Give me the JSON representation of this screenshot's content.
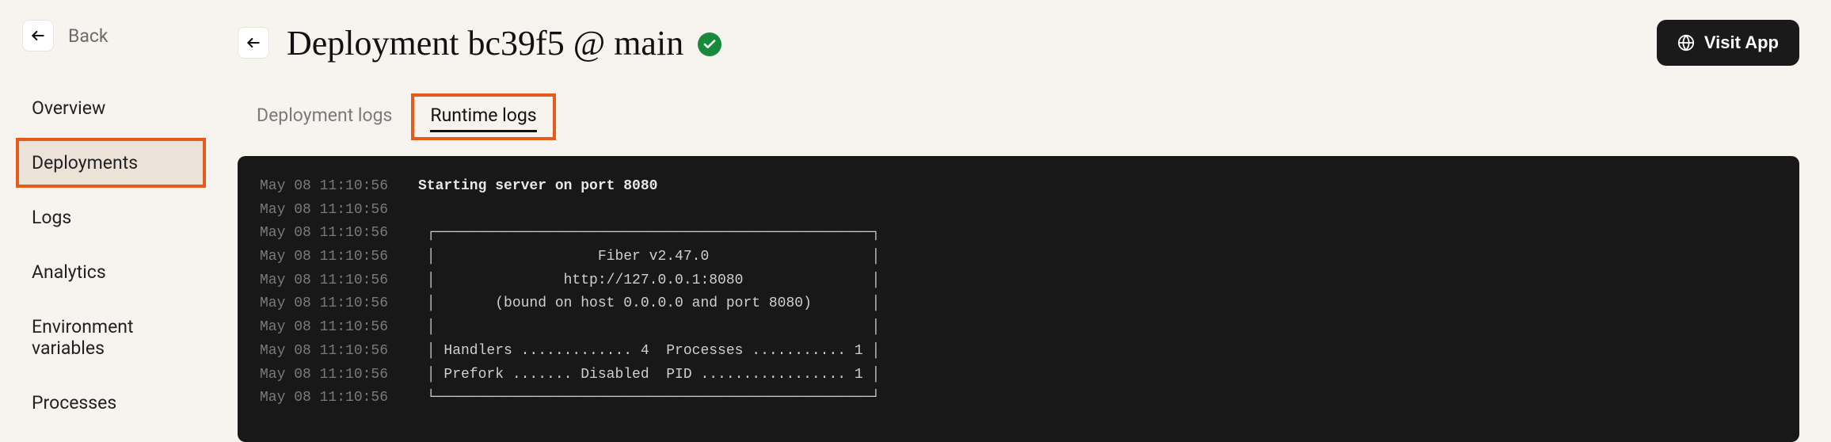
{
  "back": {
    "label": "Back"
  },
  "sidebar": {
    "items": [
      {
        "label": "Overview"
      },
      {
        "label": "Deployments"
      },
      {
        "label": "Logs"
      },
      {
        "label": "Analytics"
      },
      {
        "label": "Environment variables"
      },
      {
        "label": "Processes"
      }
    ],
    "active_index": 1
  },
  "header": {
    "title": "Deployment bc39f5 @ main",
    "status": "success",
    "visit_label": "Visit App"
  },
  "tabs": {
    "items": [
      {
        "label": "Deployment logs"
      },
      {
        "label": "Runtime logs"
      }
    ],
    "active_index": 1
  },
  "logs": [
    {
      "ts": "May 08 11:10:56",
      "msg": "Starting server on port 8080",
      "bold": true
    },
    {
      "ts": "May 08 11:10:56",
      "msg": ""
    },
    {
      "ts": "May 08 11:10:56",
      "msg": " ┌───────────────────────────────────────────────────┐ "
    },
    {
      "ts": "May 08 11:10:56",
      "msg": " │                   Fiber v2.47.0                   │ "
    },
    {
      "ts": "May 08 11:10:56",
      "msg": " │               http://127.0.0.1:8080               │ "
    },
    {
      "ts": "May 08 11:10:56",
      "msg": " │       (bound on host 0.0.0.0 and port 8080)       │ "
    },
    {
      "ts": "May 08 11:10:56",
      "msg": " │                                                   │ "
    },
    {
      "ts": "May 08 11:10:56",
      "msg": " │ Handlers ............. 4  Processes ........... 1 │ "
    },
    {
      "ts": "May 08 11:10:56",
      "msg": " │ Prefork ....... Disabled  PID ................. 1 │ "
    },
    {
      "ts": "May 08 11:10:56",
      "msg": " └───────────────────────────────────────────────────┘ "
    }
  ]
}
